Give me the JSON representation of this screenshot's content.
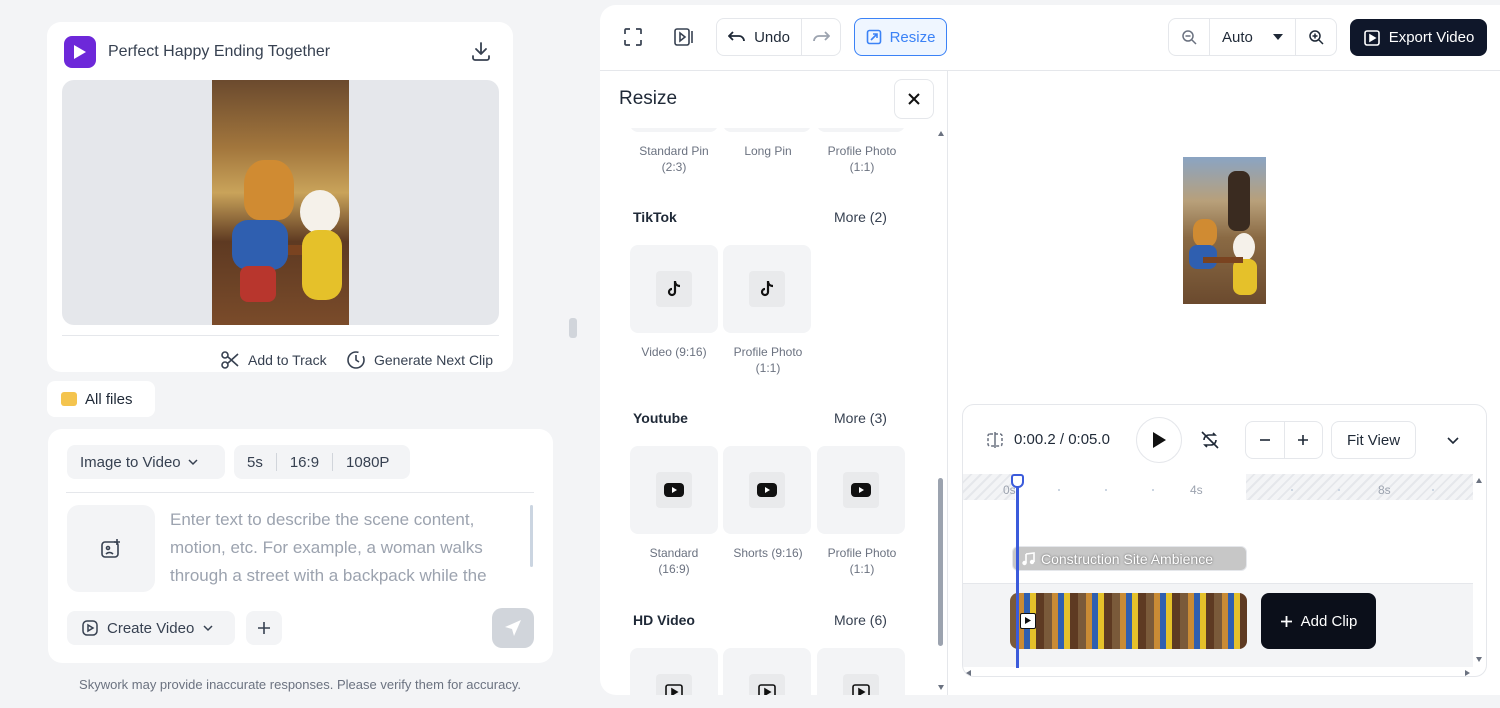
{
  "colors": {
    "accent": "#3b82f6",
    "brand": "#6d28d9",
    "dark_button": "#0f172a"
  },
  "left": {
    "project_title": "Perfect Happy Ending Together",
    "add_to_track": "Add to Track",
    "generate_next": "Generate Next Clip",
    "all_files": "All files",
    "mode": "Image to Video",
    "duration": "5s",
    "ratio": "16:9",
    "resolution": "1080P",
    "prompt_placeholder": "Enter text to describe the scene content, motion, etc. For example, a woman walks through a street with a backpack while the",
    "create": "Create Video",
    "disclaimer": "Skywork may provide inaccurate responses. Please verify them for accuracy."
  },
  "toolbar": {
    "undo": "Undo",
    "resize": "Resize",
    "zoom": "Auto",
    "export": "Export Video"
  },
  "resize_panel": {
    "title": "Resize",
    "pinterest": [
      "Standard Pin\n(2:3)",
      "Long Pin",
      "Profile Photo\n(1:1)"
    ],
    "sections": [
      {
        "name": "TikTok",
        "more": "More (2)",
        "items": [
          "Video (9:16)",
          "Profile Photo\n(1:1)"
        ]
      },
      {
        "name": "Youtube",
        "more": "More (3)",
        "items": [
          "Standard\n(16:9)",
          "Shorts (9:16)",
          "Profile Photo\n(1:1)"
        ]
      },
      {
        "name": "HD Video",
        "more": "More (6)"
      }
    ]
  },
  "timeline": {
    "time": "0:00.2 / 0:05.0",
    "fit": "Fit View",
    "ticks": [
      "0s",
      "4s",
      "8s"
    ],
    "audio_label": "Construction Site Ambience",
    "add_clip": "Add Clip"
  }
}
